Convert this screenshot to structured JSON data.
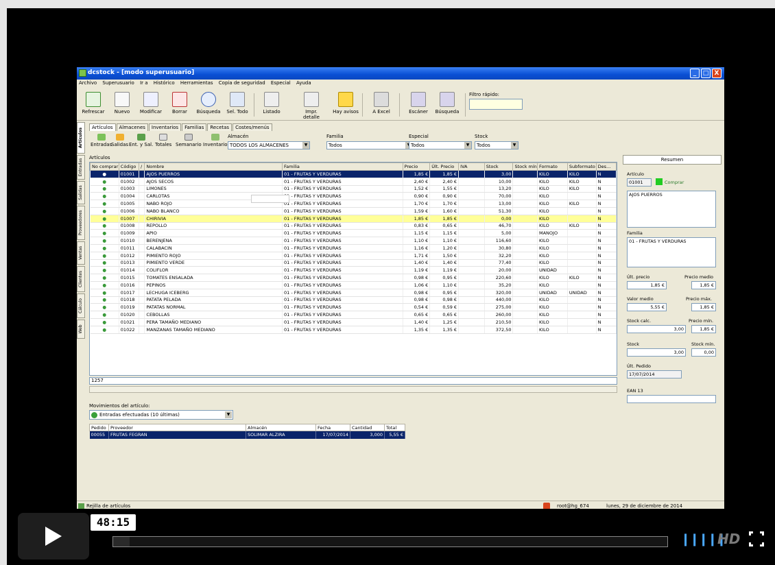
{
  "window": {
    "title": "dcstock - [modo superusuario]",
    "controls": [
      "_",
      "□",
      "X"
    ]
  },
  "menu": [
    "Archivo",
    "Superusuario",
    "Ir a",
    "Histórico",
    "Herramientas",
    "Copia de seguridad",
    "Especial",
    "Ayuda"
  ],
  "toolbar": {
    "buttons": [
      "Refrescar",
      "Nuevo",
      "Modificar",
      "Borrar",
      "Búsqueda",
      "Sel. Todo",
      "Listado",
      "Impr. detalle",
      "Hay avisos",
      "A Excel",
      "Escáner",
      "Búsqueda"
    ],
    "filter_label": "Filtro rápido:",
    "filter_value": ""
  },
  "vertical_tabs": [
    "Artículos",
    "Entradas",
    "Salidas",
    "Proveedores",
    "Ventas",
    "Clientes",
    "Cálculo",
    "Web"
  ],
  "tabs": [
    "Artículos",
    "Almacenes",
    "Inventarios",
    "Familias",
    "Recetas",
    "Costes/menús"
  ],
  "subtoolbar": {
    "buttons": [
      "Entradas",
      "Salidas",
      "Ent. y Sal.",
      "Totales",
      "Semanario",
      "Inventario"
    ],
    "almacen_label": "Almacén",
    "almacen_value": "TODOS LOS ALMACENES",
    "familia_label": "Familia",
    "familia_value": "Todos",
    "especial_label": "Especial",
    "especial_value": "Todos",
    "stock_label": "Stock",
    "stock_value": "Todos"
  },
  "grid": {
    "title": "Artículos",
    "columns": [
      "No comprar",
      "Código",
      "/",
      "Nombre",
      "Familia",
      "Precio",
      "Últ. Precio",
      "IVA",
      "Stock",
      "Stock mín.",
      "Formato",
      "Subformato",
      "Des..."
    ],
    "rows": [
      {
        "mark": "●",
        "code": "01001",
        "name": "AJOS PUERROS",
        "fam": "01 - FRUTAS Y VERDURAS",
        "precio": "1,85 €",
        "ult": "1,85 €",
        "iva": "",
        "stock": "3,00",
        "min": "",
        "fmt": "KILO",
        "sub": "KILO",
        "des": "N"
      },
      {
        "mark": "●",
        "code": "01002",
        "name": "AJOS SECOS",
        "fam": "01 - FRUTAS Y VERDURAS",
        "precio": "2,40 €",
        "ult": "2,40 €",
        "iva": "",
        "stock": "10,00",
        "min": "",
        "fmt": "KILO",
        "sub": "KILO",
        "des": "N"
      },
      {
        "mark": "●",
        "code": "01003",
        "name": "LIMONES",
        "fam": "01 - FRUTAS Y VERDURAS",
        "precio": "1,52 €",
        "ult": "1,55 €",
        "iva": "",
        "stock": "13,20",
        "min": "",
        "fmt": "KILO",
        "sub": "KILO",
        "des": "N"
      },
      {
        "mark": "●",
        "code": "01004",
        "name": "CARLOTAS",
        "fam": "01 - FRUTAS Y VERDURAS",
        "precio": "0,90 €",
        "ult": "0,90 €",
        "iva": "",
        "stock": "70,00",
        "min": "",
        "fmt": "KILO",
        "sub": "",
        "des": "N"
      },
      {
        "mark": "●",
        "code": "01005",
        "name": "NABO ROJO",
        "fam": "01 - FRUTAS Y VERDURAS",
        "precio": "1,70 €",
        "ult": "1,70 €",
        "iva": "",
        "stock": "13,00",
        "min": "",
        "fmt": "KILO",
        "sub": "KILO",
        "des": "N"
      },
      {
        "mark": "●",
        "code": "01006",
        "name": "NABO BLANCO",
        "fam": "01 - FRUTAS Y VERDURAS",
        "precio": "1,59 €",
        "ult": "1,60 €",
        "iva": "",
        "stock": "51,30",
        "min": "",
        "fmt": "KILO",
        "sub": "",
        "des": "N"
      },
      {
        "mark": "●",
        "code": "01007",
        "name": "CHIRIVIA",
        "fam": "01 - FRUTAS Y VERDURAS",
        "precio": "1,85 €",
        "ult": "1,85 €",
        "iva": "",
        "stock": "0,00",
        "min": "",
        "fmt": "KILO",
        "sub": "",
        "des": "N"
      },
      {
        "mark": "●",
        "code": "01008",
        "name": "REPOLLO",
        "fam": "01 - FRUTAS Y VERDURAS",
        "precio": "0,83 €",
        "ult": "0,65 €",
        "iva": "",
        "stock": "46,70",
        "min": "",
        "fmt": "KILO",
        "sub": "KILO",
        "des": "N"
      },
      {
        "mark": "●",
        "code": "01009",
        "name": "APIO",
        "fam": "01 - FRUTAS Y VERDURAS",
        "precio": "1,15 €",
        "ult": "1,15 €",
        "iva": "",
        "stock": "5,00",
        "min": "",
        "fmt": "MANOJO",
        "sub": "",
        "des": "N"
      },
      {
        "mark": "●",
        "code": "01010",
        "name": "BERENJENA",
        "fam": "01 - FRUTAS Y VERDURAS",
        "precio": "1,10 €",
        "ult": "1,10 €",
        "iva": "",
        "stock": "116,60",
        "min": "",
        "fmt": "KILO",
        "sub": "",
        "des": "N"
      },
      {
        "mark": "●",
        "code": "01011",
        "name": "CALABACIN",
        "fam": "01 - FRUTAS Y VERDURAS",
        "precio": "1,16 €",
        "ult": "1,20 €",
        "iva": "",
        "stock": "30,80",
        "min": "",
        "fmt": "KILO",
        "sub": "",
        "des": "N"
      },
      {
        "mark": "●",
        "code": "01012",
        "name": "PIMIENTO ROJO",
        "fam": "01 - FRUTAS Y VERDURAS",
        "precio": "1,71 €",
        "ult": "1,50 €",
        "iva": "",
        "stock": "32,20",
        "min": "",
        "fmt": "KILO",
        "sub": "",
        "des": "N"
      },
      {
        "mark": "●",
        "code": "01013",
        "name": "PIMIENTO VERDE",
        "fam": "01 - FRUTAS Y VERDURAS",
        "precio": "1,40 €",
        "ult": "1,40 €",
        "iva": "",
        "stock": "77,40",
        "min": "",
        "fmt": "KILO",
        "sub": "",
        "des": "N"
      },
      {
        "mark": "●",
        "code": "01014",
        "name": "COLIFLOR",
        "fam": "01 - FRUTAS Y VERDURAS",
        "precio": "1,19 €",
        "ult": "1,19 €",
        "iva": "",
        "stock": "20,00",
        "min": "",
        "fmt": "UNIDAD",
        "sub": "",
        "des": "N"
      },
      {
        "mark": "●",
        "code": "01015",
        "name": "TOMATES ENSALADA",
        "fam": "01 - FRUTAS Y VERDURAS",
        "precio": "0,98 €",
        "ult": "0,95 €",
        "iva": "",
        "stock": "220,60",
        "min": "",
        "fmt": "KILO",
        "sub": "KILO",
        "des": "N"
      },
      {
        "mark": "●",
        "code": "01016",
        "name": "PEPINOS",
        "fam": "01 - FRUTAS Y VERDURAS",
        "precio": "1,06 €",
        "ult": "1,10 €",
        "iva": "",
        "stock": "35,20",
        "min": "",
        "fmt": "KILO",
        "sub": "",
        "des": "N"
      },
      {
        "mark": "●",
        "code": "01017",
        "name": "LECHUGA ICEBERG",
        "fam": "01 - FRUTAS Y VERDURAS",
        "precio": "0,98 €",
        "ult": "0,95 €",
        "iva": "",
        "stock": "320,00",
        "min": "",
        "fmt": "UNIDAD",
        "sub": "UNIDAD",
        "des": "N"
      },
      {
        "mark": "●",
        "code": "01018",
        "name": "PATATA PELADA",
        "fam": "01 - FRUTAS Y VERDURAS",
        "precio": "0,98 €",
        "ult": "0,98 €",
        "iva": "",
        "stock": "440,00",
        "min": "",
        "fmt": "KILO",
        "sub": "",
        "des": "N"
      },
      {
        "mark": "●",
        "code": "01019",
        "name": "PATATAS NORMAL",
        "fam": "01 - FRUTAS Y VERDURAS",
        "precio": "0,54 €",
        "ult": "0,59 €",
        "iva": "",
        "stock": "275,00",
        "min": "",
        "fmt": "KILO",
        "sub": "",
        "des": "N"
      },
      {
        "mark": "●",
        "code": "01020",
        "name": "CEBOLLAS",
        "fam": "01 - FRUTAS Y VERDURAS",
        "precio": "0,65 €",
        "ult": "0,65 €",
        "iva": "",
        "stock": "260,00",
        "min": "",
        "fmt": "KILO",
        "sub": "",
        "des": "N"
      },
      {
        "mark": "●",
        "code": "01021",
        "name": "PERA TAMAÑO MEDIANO",
        "fam": "01 - FRUTAS Y VERDURAS",
        "precio": "1,40 €",
        "ult": "1,25 €",
        "iva": "",
        "stock": "210,50",
        "min": "",
        "fmt": "KILO",
        "sub": "",
        "des": "N"
      },
      {
        "mark": "●",
        "code": "01022",
        "name": "MANZANAS TAMAÑO MEDIANO",
        "fam": "01 - FRUTAS Y VERDURAS",
        "precio": "1,35 €",
        "ult": "1,35 €",
        "iva": "",
        "stock": "372,50",
        "min": "",
        "fmt": "KILO",
        "sub": "",
        "des": "N"
      }
    ],
    "footer_count": "1257"
  },
  "side": {
    "header": "Resumen",
    "articulo_label": "Artículo",
    "articulo_code": "01001",
    "comprar_label": "Comprar",
    "articulo_name": "AJOS PUERROS",
    "familia_label": "Familia",
    "familia_value": "01 - FRUTAS Y VERDURAS",
    "ult_precio_label": "Últ. precio",
    "ult_precio_value": "1,85 €",
    "precio_medio_label": "Precio medio",
    "precio_medio_value": "1,85 €",
    "valor_medio_label": "Valor medio",
    "valor_medio_value": "5,55 €",
    "precio_max_label": "Precio máx.",
    "precio_max_value": "1,85 €",
    "stock_calc_label": "Stock calc.",
    "stock_calc_value": "3,00",
    "precio_min_label": "Precio mín.",
    "precio_min_value": "1,85 €",
    "stock_label": "Stock",
    "stock_value": "3,00",
    "stock_min_label": "Stock mín.",
    "stock_min_value": "0,00",
    "ult_pedido_label": "Últ. Pedido",
    "ult_pedido_value": "17/07/2014",
    "ean_label": "EAN 13",
    "ean_value": ""
  },
  "movimientos": {
    "title": "Movimientos del artículo:",
    "select_value": "Entradas efectuadas (10 últimas)",
    "columns": [
      "Pedido",
      "Proveedor",
      "Almacén",
      "Fecha",
      "Cantidad",
      "Total"
    ],
    "rows": [
      {
        "pedido": "00055",
        "proveedor": "FRUTAS FEGRAN",
        "almacen": "SOLIMAR ALZIRA",
        "fecha": "17/07/2014",
        "cantidad": "3,000",
        "total": "5,55 €"
      }
    ]
  },
  "statusbar": {
    "left": "Rejilla de artículos",
    "user": "root@hg_674",
    "date": "lunes, 29 de diciembre de 2014"
  },
  "player": {
    "time": "48:15",
    "hd_label": "HD",
    "progress": 0.03
  },
  "colors": {
    "selection": "#0a246a",
    "highlight_row": "#ffff99",
    "titlebar": "#0a4fd4",
    "player_accent": "#4aa8ff"
  }
}
